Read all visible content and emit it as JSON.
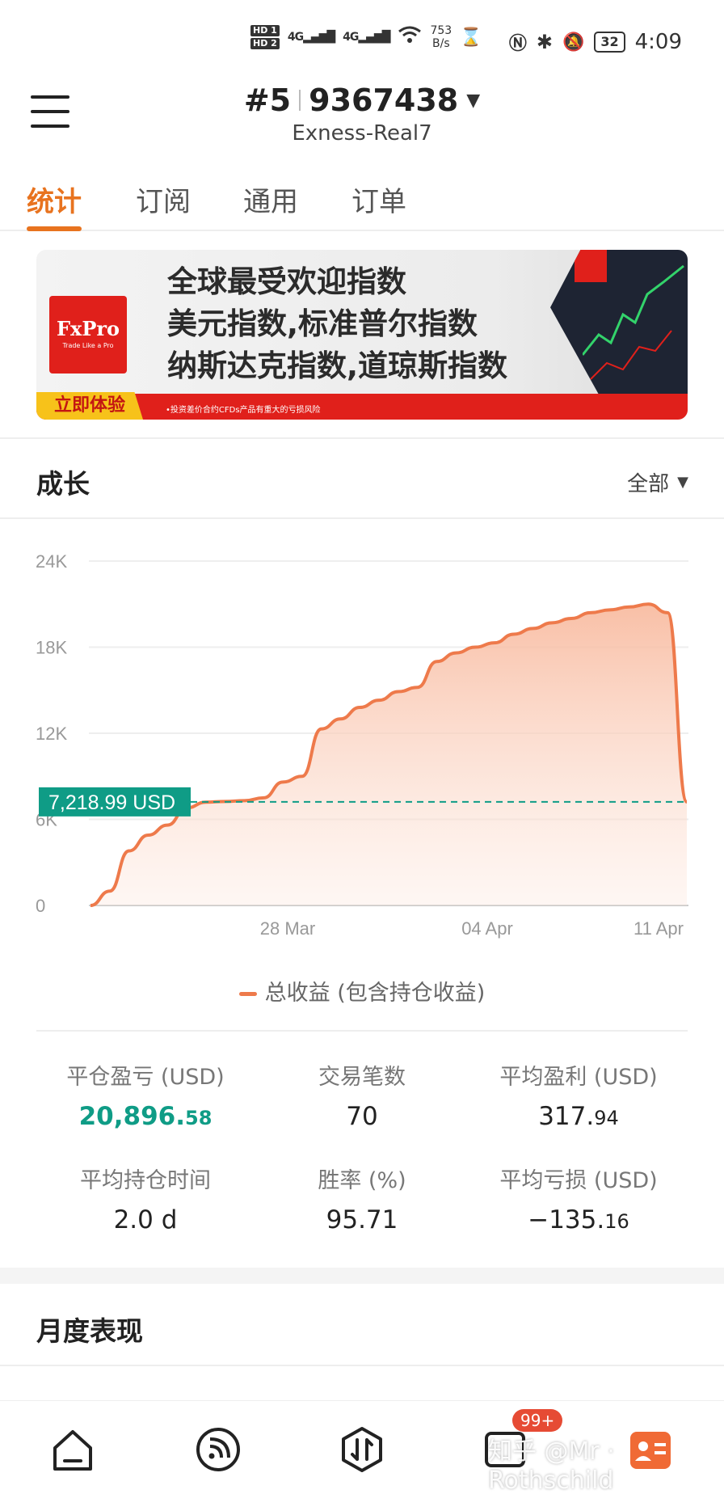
{
  "status_bar": {
    "hd1": "HD 1",
    "hd2": "HD 2",
    "signal1": "4G",
    "signal2": "4G",
    "speed_value": "753",
    "speed_unit": "B/s",
    "battery": "32",
    "time": "4:09"
  },
  "header": {
    "account_rank": "#5",
    "account_number": "9367438",
    "server": "Exness-Real7"
  },
  "tabs": [
    {
      "label": "统计",
      "active": true
    },
    {
      "label": "订阅",
      "active": false
    },
    {
      "label": "通用",
      "active": false
    },
    {
      "label": "订单",
      "active": false
    }
  ],
  "banner": {
    "logo_text": "FxPro",
    "logo_tagline": "Trade Like a Pro",
    "line1": "全球最受欢迎指数",
    "line2": "美元指数,标准普尔指数",
    "line3": "纳斯达克指数,道琼斯指数",
    "cta": "立即体验",
    "note": "•投资差价合约CFDs产品有重大的亏损风险"
  },
  "growth": {
    "title": "成长",
    "filter": "全部",
    "legend": "总收益 (包含持仓收益)",
    "marker_label": "7,218.99 USD"
  },
  "chart_data": {
    "type": "area",
    "y_ticks": [
      "24K",
      "18K",
      "12K",
      "6K",
      "0"
    ],
    "x_ticks": [
      "28 Mar",
      "04 Apr",
      "11 Apr"
    ],
    "ylim": [
      0,
      24000
    ],
    "reference_value": 7218.99,
    "series": [
      {
        "name": "总收益 (包含持仓收益)",
        "values": [
          0,
          1000,
          3800,
          4900,
          5600,
          6800,
          7200,
          7250,
          7300,
          7500,
          8600,
          9000,
          12300,
          13000,
          13800,
          14300,
          14900,
          15200,
          17000,
          17600,
          18000,
          18300,
          18900,
          19300,
          19700,
          20000,
          20400,
          20600,
          20800,
          21000,
          20400,
          7218.99
        ]
      }
    ],
    "colors": {
      "line": "#ee7a4b",
      "fill": "#fbd5c4",
      "reference": "#0f9c86"
    }
  },
  "stats": [
    {
      "label": "平仓盈亏 (USD)",
      "int": "20,896.",
      "dec": "58",
      "green": true
    },
    {
      "label": "交易笔数",
      "int": "70",
      "dec": "",
      "green": false
    },
    {
      "label": "平均盈利 (USD)",
      "int": "317.",
      "dec": "94",
      "green": false
    },
    {
      "label": "平均持仓时间",
      "int": "2.0 d",
      "dec": "",
      "green": false
    },
    {
      "label": "胜率 (%)",
      "int": "95.71",
      "dec": "",
      "green": false
    },
    {
      "label": "平均亏损 (USD)",
      "int": "−135.",
      "dec": "16",
      "green": false
    }
  ],
  "monthly": {
    "title": "月度表现"
  },
  "bottom_nav": {
    "badge": "99+",
    "icons": [
      "home-icon",
      "feed-icon",
      "trade-icon",
      "message-icon",
      "profile-icon"
    ]
  },
  "watermark": "知乎 @Mr · Rothschild"
}
